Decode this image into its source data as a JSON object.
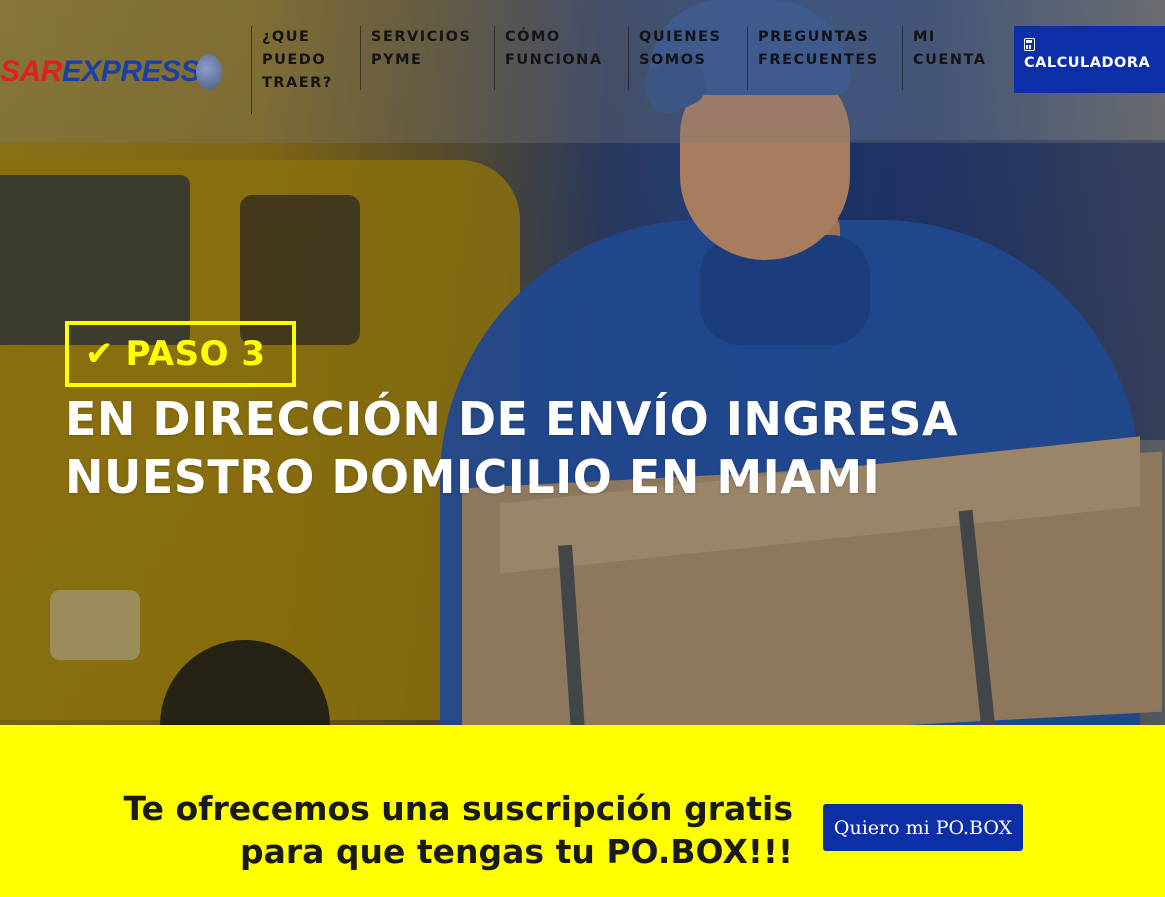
{
  "header": {
    "logo": {
      "part1": "SAR",
      "part2": "EXPRESS"
    },
    "nav": [
      {
        "lines": [
          "¿QUE",
          "PUEDO",
          "TRAER?"
        ]
      },
      {
        "lines": [
          "SERVICIOS",
          "PYME"
        ]
      },
      {
        "lines": [
          "CÓMO",
          "FUNCIONA"
        ]
      },
      {
        "lines": [
          "QUIENES",
          "SOMOS"
        ]
      },
      {
        "lines": [
          "PREGUNTAS",
          "FRECUENTES"
        ]
      },
      {
        "lines": [
          "MI",
          "CUENTA"
        ]
      }
    ],
    "calculator": {
      "label": "CALCULADORA",
      "icon": "calculator-icon"
    }
  },
  "hero": {
    "badge": {
      "icon": "checkmark-icon",
      "label": "PASO 3"
    },
    "headline": [
      "EN DIRECCIÓN DE ENVÍO INGRESA",
      "NUESTRO DOMICILIO EN MIAMI"
    ]
  },
  "cta": {
    "text_lines": [
      "Te ofrecemos una suscripción gratis",
      "para que tengas tu PO.BOX!!!"
    ],
    "button_label": "Quiero mi PO.BOX"
  },
  "colors": {
    "accent_yellow": "#ffff00",
    "brand_blue": "#0c2fa8",
    "logo_red": "#e0201e",
    "logo_blue": "#1b3fa8"
  }
}
